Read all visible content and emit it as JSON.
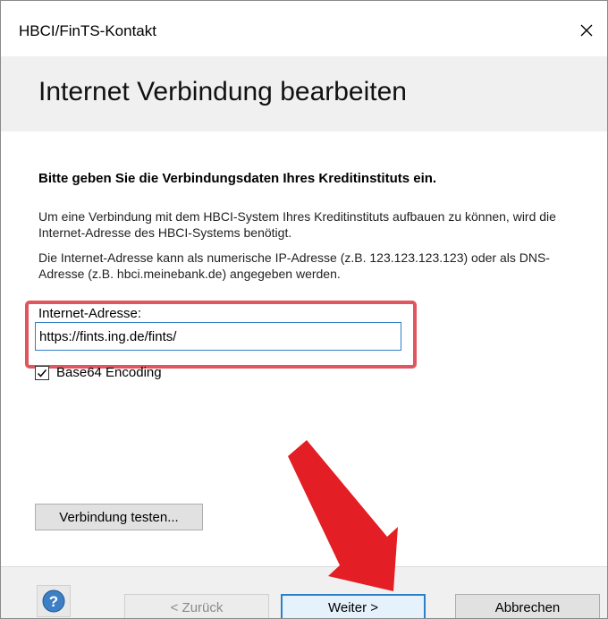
{
  "window": {
    "title": "HBCI/FinTS-Kontakt",
    "close_label": "×"
  },
  "header": {
    "title": "Internet Verbindung bearbeiten"
  },
  "content": {
    "instruction": "Bitte geben Sie die Verbindungsdaten Ihres Kreditinstituts ein.",
    "para1": "Um eine Verbindung mit dem HBCI-System Ihres Kreditinstituts aufbauen zu können, wird die Internet-Adresse des HBCI-Systems benötigt.",
    "para2": "Die Internet-Adresse kann als numerische IP-Adresse (z.B. 123.123.123.123) oder als DNS-Adresse (z.B. hbci.meinebank.de) angegeben werden.",
    "address_label": "Internet-Adresse:",
    "address_value": "https://fints.ing.de/fints/",
    "base64_label": "Base64 Encoding",
    "base64_checked": true,
    "test_button": "Verbindung testen..."
  },
  "footer": {
    "help_icon": "question-icon",
    "back_button": "< Zurück",
    "next_button": "Weiter >",
    "cancel_button": "Abbrechen"
  },
  "colors": {
    "highlight": "#e0555e",
    "arrow": "#e31e24",
    "focus": "#2f7fc8"
  }
}
